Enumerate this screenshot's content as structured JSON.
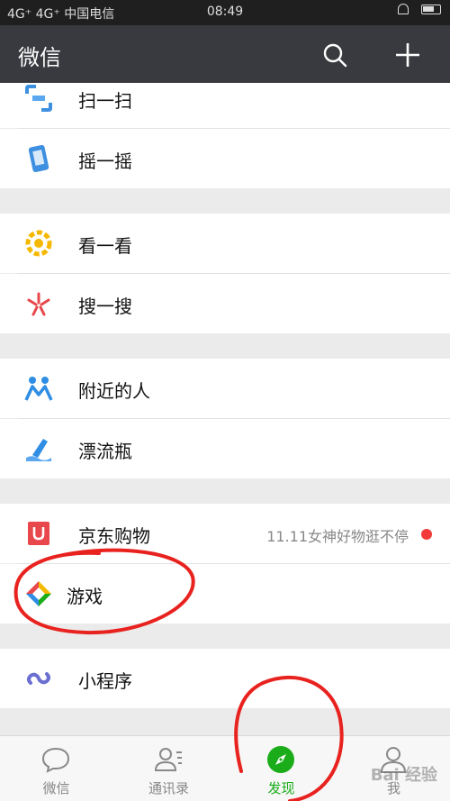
{
  "status_bar": {
    "signal": "4G⁺ 4G⁺ 中国电信",
    "time": "08:49"
  },
  "nav": {
    "title": "微信",
    "search_icon": "search-icon",
    "add_icon": "plus-icon"
  },
  "sections": [
    {
      "items": [
        {
          "label": "扫一扫",
          "icon": "scan-icon"
        },
        {
          "label": "摇一摇",
          "icon": "shake-icon"
        }
      ]
    },
    {
      "items": [
        {
          "label": "看一看",
          "icon": "top-stories-icon"
        },
        {
          "label": "搜一搜",
          "icon": "search-sparkle-icon"
        }
      ]
    },
    {
      "items": [
        {
          "label": "附近的人",
          "icon": "people-nearby-icon"
        },
        {
          "label": "漂流瓶",
          "icon": "drift-bottle-icon"
        }
      ]
    },
    {
      "items": [
        {
          "label": "京东购物",
          "icon": "jd-shopping-icon",
          "extra": "11.11女神好物逛不停",
          "badge": true
        },
        {
          "label": "游戏",
          "icon": "games-icon"
        }
      ]
    },
    {
      "items": [
        {
          "label": "小程序",
          "icon": "mini-program-icon"
        }
      ]
    }
  ],
  "tabs": [
    {
      "label": "微信",
      "icon": "chat-icon",
      "active": false
    },
    {
      "label": "通讯录",
      "icon": "contacts-icon",
      "active": false
    },
    {
      "label": "发现",
      "icon": "discover-compass-icon",
      "active": true
    },
    {
      "label": "我",
      "icon": "me-icon",
      "active": false
    }
  ],
  "watermark": "Bai 经验",
  "colors": {
    "navbar": "#393a3f",
    "active_tab": "#1aad19",
    "badge": "#f23a3a",
    "annotation": "#e8221e"
  }
}
